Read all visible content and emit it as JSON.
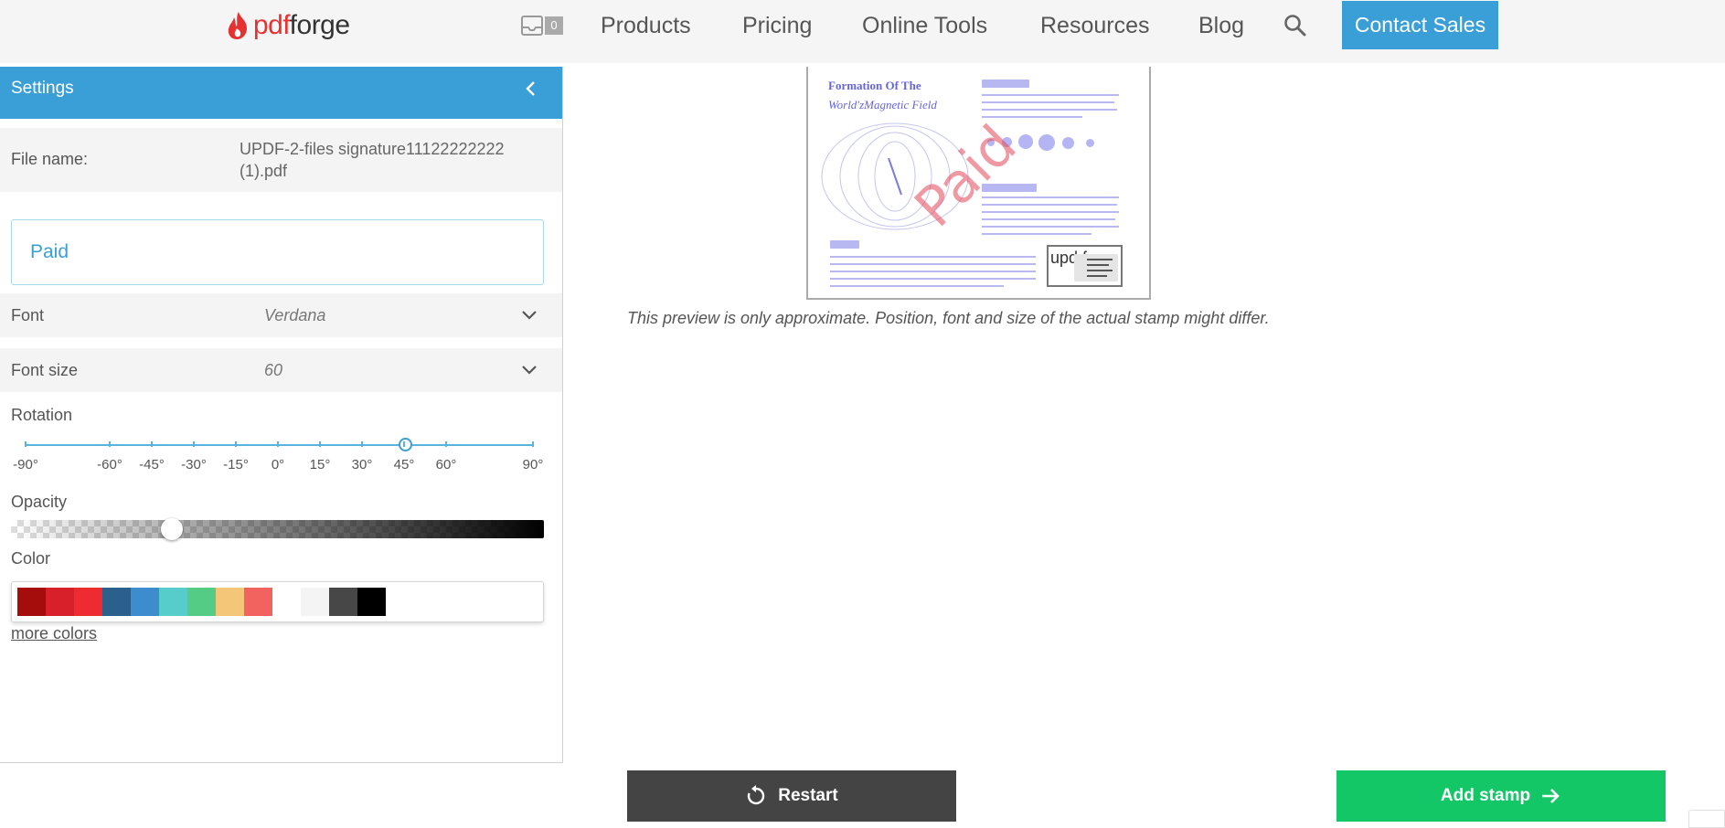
{
  "brand": {
    "pdf": "pdf",
    "forge": "forge",
    "accent": "#3a9fd6",
    "red": "#e63131"
  },
  "header": {
    "inbox_count": "0",
    "nav": [
      "Products",
      "Pricing",
      "Online Tools",
      "Resources",
      "Blog"
    ],
    "contact_label": "Contact Sales"
  },
  "panel": {
    "title": "Settings",
    "file_label": "File name:",
    "file_value": "UPDF-2-files signature11122222222 (1).pdf",
    "stamp_text": "Paid",
    "font_label": "Font",
    "font_value": "Verdana",
    "font_size_label": "Font size",
    "font_size_value": "60",
    "rotation_label": "Rotation",
    "rotation_ticks": [
      "-90°",
      "-60°",
      "-45°",
      "-30°",
      "-15°",
      "0°",
      "15°",
      "30°",
      "45°",
      "60°",
      "90°"
    ],
    "rotation_value": 45,
    "opacity_label": "Opacity",
    "opacity_fraction": 0.3,
    "color_label": "Color",
    "colors": [
      "#a50d0d",
      "#d7202a",
      "#ee2b30",
      "#2b5f8c",
      "#3d8ccd",
      "#56cccb",
      "#55cc86",
      "#f3c678",
      "#f2625e",
      "#ffffff",
      "#f4f4f4",
      "#474747",
      "#000000"
    ],
    "more_colors": "more colors"
  },
  "preview": {
    "title_line1": "Formation Of The",
    "title_line2": "World'zMagnetic Field",
    "stamp": "Paid",
    "sig_text": "upd f",
    "note": "This preview is only approximate. Position, font and size of the actual stamp might differ."
  },
  "actions": {
    "restart": "Restart",
    "add_stamp": "Add stamp"
  }
}
